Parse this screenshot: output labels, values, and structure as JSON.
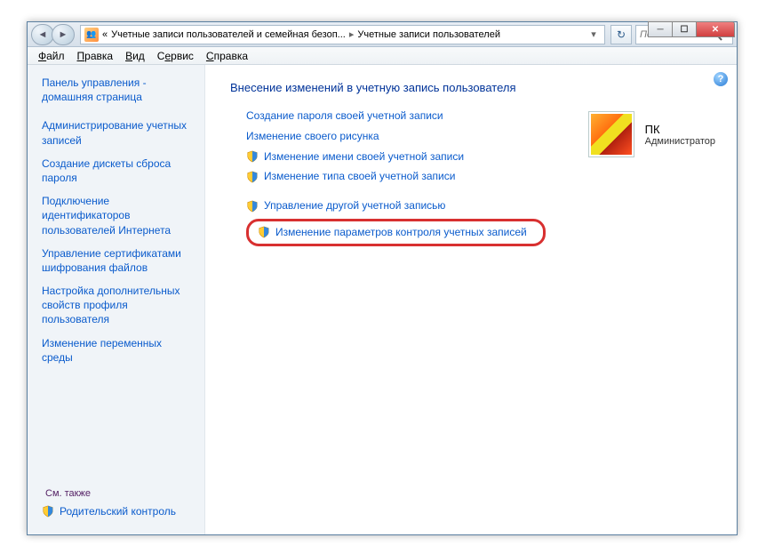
{
  "titlebar": {
    "back_glyph": "◄",
    "fwd_glyph": "►",
    "crumb_prefix": "«",
    "crumb1": "Учетные записи пользователей и семейная безоп...",
    "crumb2": "Учетные записи пользователей",
    "search_placeholder": "Поиск в па...",
    "refresh_glyph": "↻",
    "min": "─",
    "max": "☐",
    "close": "✕"
  },
  "menu": {
    "file": "Файл",
    "edit": "Правка",
    "view": "Вид",
    "service": "Сервис",
    "help": "Справка"
  },
  "sidebar": {
    "home": "Панель управления - домашняя страница",
    "items": [
      "Администрирование учетных записей",
      "Создание дискеты сброса пароля",
      "Подключение идентификаторов пользователей Интернета",
      "Управление сертификатами шифрования файлов",
      "Настройка дополнительных свойств профиля пользователя",
      "Изменение переменных среды"
    ],
    "seealso": "См. также",
    "parental": "Родительский контроль"
  },
  "main": {
    "heading": "Внесение изменений в учетную запись пользователя",
    "tasks_plain": [
      "Создание пароля своей учетной записи",
      "Изменение своего рисунка"
    ],
    "tasks_shield": [
      "Изменение имени своей учетной записи",
      "Изменение типа своей учетной записи"
    ],
    "tasks_bottom": [
      "Управление другой учетной записью",
      "Изменение параметров контроля учетных записей"
    ],
    "help_glyph": "?"
  },
  "account": {
    "name": "ПК",
    "role": "Администратор"
  }
}
